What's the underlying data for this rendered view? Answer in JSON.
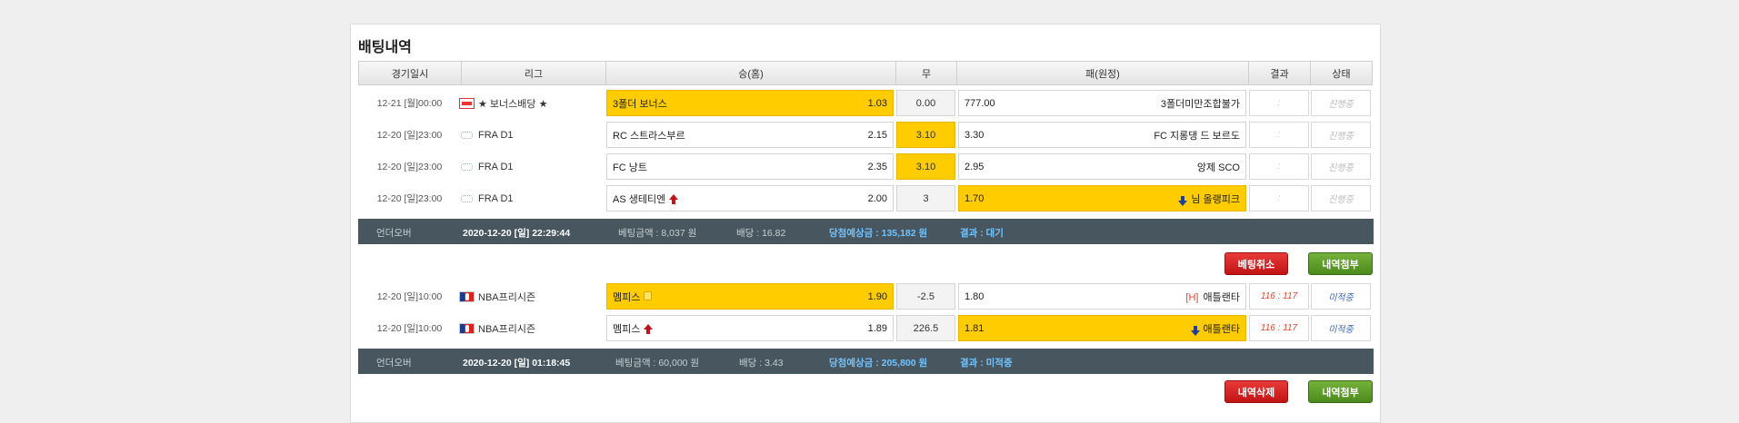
{
  "title": "배팅내역",
  "headers": {
    "date": "경기일시",
    "league": "리그",
    "home": "승(홈)",
    "draw": "무",
    "away": "패(원정)",
    "result": "결과",
    "status": "상태"
  },
  "group1": {
    "rows": [
      {
        "date": "12-21 [월]00:00",
        "league": "★ 보너스배당 ★",
        "flag": "bonus-icon",
        "home": "3폴더 보너스",
        "home_odds": "1.03",
        "draw": "0.00",
        "away_odds": "777.00",
        "away": "3폴더미만조합불가",
        "result": ":",
        "status": "진행중"
      },
      {
        "date": "12-20 [일]23:00",
        "league": "FRA D1",
        "flag": "soccer-league-icon",
        "home": "RC 스트라스부르",
        "home_odds": "2.15",
        "draw": "3.10",
        "away_odds": "3.30",
        "away": "FC 지롱댕 드 보르도",
        "result": ":",
        "status": "진행중"
      },
      {
        "date": "12-20 [일]23:00",
        "league": "FRA D1",
        "flag": "soccer-league-icon",
        "home": "FC 낭트",
        "home_odds": "2.35",
        "draw": "3.10",
        "away_odds": "2.95",
        "away": "앙제 SCO",
        "result": ":",
        "status": "진행중"
      },
      {
        "date": "12-20 [일]23:00",
        "league": "FRA D1",
        "flag": "soccer-league-icon",
        "home": "AS 생테티엔",
        "home_odds": "2.00",
        "draw": "3",
        "away_odds": "1.70",
        "away": "님 올랭피크",
        "result": ":",
        "status": "진행중"
      }
    ],
    "summary": {
      "type": "언더오버",
      "datetime": "2020-12-20 [일] 22:29:44",
      "amount": "베팅금액 : 8,037 원",
      "odds": "배당 : 16.82",
      "expected": "당첨예상금 : 135,182 원",
      "result": "결과 : 대기"
    },
    "buttons": {
      "cancel": "베팅취소",
      "attach": "내역첨부"
    }
  },
  "group2": {
    "rows": [
      {
        "date": "12-20 [일]10:00",
        "league": "NBA프리시즌",
        "flag": "nba-icon",
        "home": "멤피스",
        "home_odds": "1.90",
        "draw": "-2.5",
        "away_odds": "1.80",
        "away_mark": "[H]",
        "away": "애틀랜타",
        "result": "116 : 117",
        "status": "미적중"
      },
      {
        "date": "12-20 [일]10:00",
        "league": "NBA프리시즌",
        "flag": "nba-icon",
        "home": "멤피스",
        "home_odds": "1.89",
        "draw": "226.5",
        "away_odds": "1.81",
        "away": "애틀랜타",
        "result": "116 : 117",
        "status": "미적중"
      }
    ],
    "summary": {
      "type": "언더오버",
      "datetime": "2020-12-20 [일] 01:18:45",
      "amount": "베팅금액 : 60,000 원",
      "odds": "배당 : 3.43",
      "expected": "당첨예상금 : 205,800 원",
      "result": "결과 : 미적중"
    },
    "buttons": {
      "delete": "내역삭제",
      "attach": "내역첨부"
    }
  },
  "colors": {
    "selected": "#ffcc00",
    "summary_bg": "#48575f",
    "accent_blue": "#71c3ff",
    "button_red": "#c21414",
    "button_green": "#4c8a1c"
  }
}
